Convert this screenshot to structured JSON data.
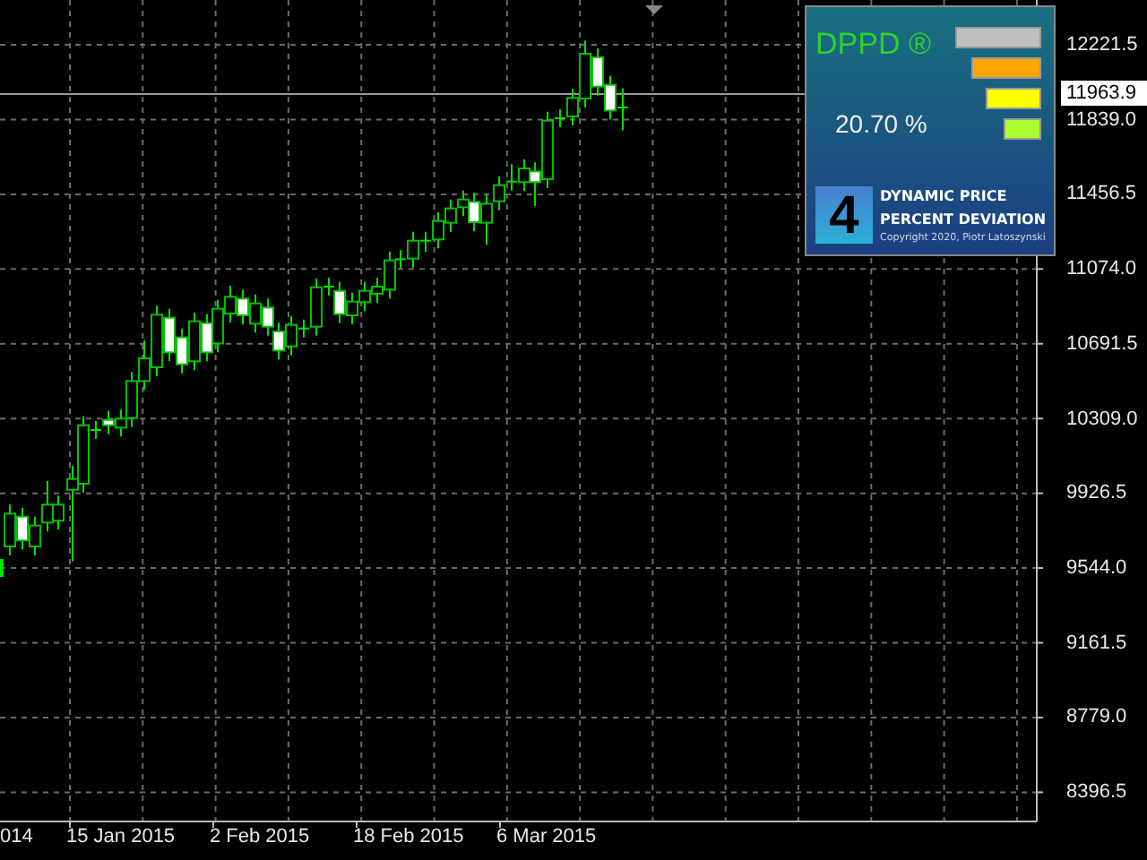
{
  "indicator_panel": {
    "title": "DPPD ®",
    "percent": "20.70 %",
    "bars": [
      {
        "color": "#c0c0c0"
      },
      {
        "color": "#ffa500"
      },
      {
        "color": "#ffff00"
      },
      {
        "color": "#adff2f"
      }
    ],
    "logo": {
      "mark": "4",
      "title_lines": [
        "DYNAMIC PRICE",
        "PERCENT DEVIATION"
      ],
      "copyright": "Copyright 2020, Piotr Latoszynski"
    }
  },
  "price_axis": {
    "labels": [
      "12221.5",
      "11839.0",
      "11456.5",
      "11074.0",
      "10691.5",
      "10309.0",
      "9926.5",
      "9544.0",
      "9161.5",
      "8779.0",
      "8396.5"
    ],
    "current_price": "11963.9"
  },
  "time_axis": {
    "labels": [
      "014",
      "15 Jan 2015",
      "2 Feb 2015",
      "18 Feb 2015",
      "6 Mar 2015"
    ]
  }
}
